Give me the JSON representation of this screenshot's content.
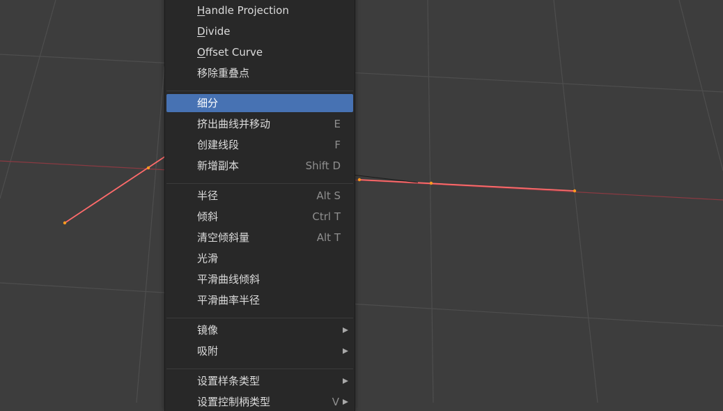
{
  "menu": {
    "groups": [
      [
        {
          "label": "Handle Projection"
        },
        {
          "label": "Divide"
        },
        {
          "label": "Offset Curve"
        },
        {
          "label": "移除重叠点"
        }
      ],
      [
        {
          "label": "细分",
          "active": true
        },
        {
          "label": "挤出曲线并移动",
          "shortcut": "E"
        },
        {
          "label": "创建线段",
          "shortcut": "F"
        },
        {
          "label": "新增副本",
          "shortcut": "Shift D"
        }
      ],
      [
        {
          "label": "半径",
          "shortcut": "Alt S"
        },
        {
          "label": "倾斜",
          "shortcut": "Ctrl T"
        },
        {
          "label": "清空倾斜量",
          "shortcut": "Alt T"
        },
        {
          "label": "光滑"
        },
        {
          "label": "平滑曲线倾斜"
        },
        {
          "label": "平滑曲率半径"
        }
      ],
      [
        {
          "label": "镜像",
          "submenu": true
        },
        {
          "label": "吸附",
          "submenu": true
        }
      ],
      [
        {
          "label": "设置样条类型",
          "submenu": true
        },
        {
          "label": "设置控制柄类型",
          "shortcut": "V",
          "submenu": true
        }
      ]
    ]
  },
  "colors": {
    "viewport_bg": "#3d3d3d",
    "grid_line": "#4e4e4e",
    "x_axis": "#8a3a42",
    "curve": "#ff6b6b",
    "control_point": "#ff9a1f",
    "menu_bg": "#282828",
    "highlight": "#4772b3",
    "text": "#dcdcdc",
    "shortcut_text": "#8f8f8f"
  }
}
